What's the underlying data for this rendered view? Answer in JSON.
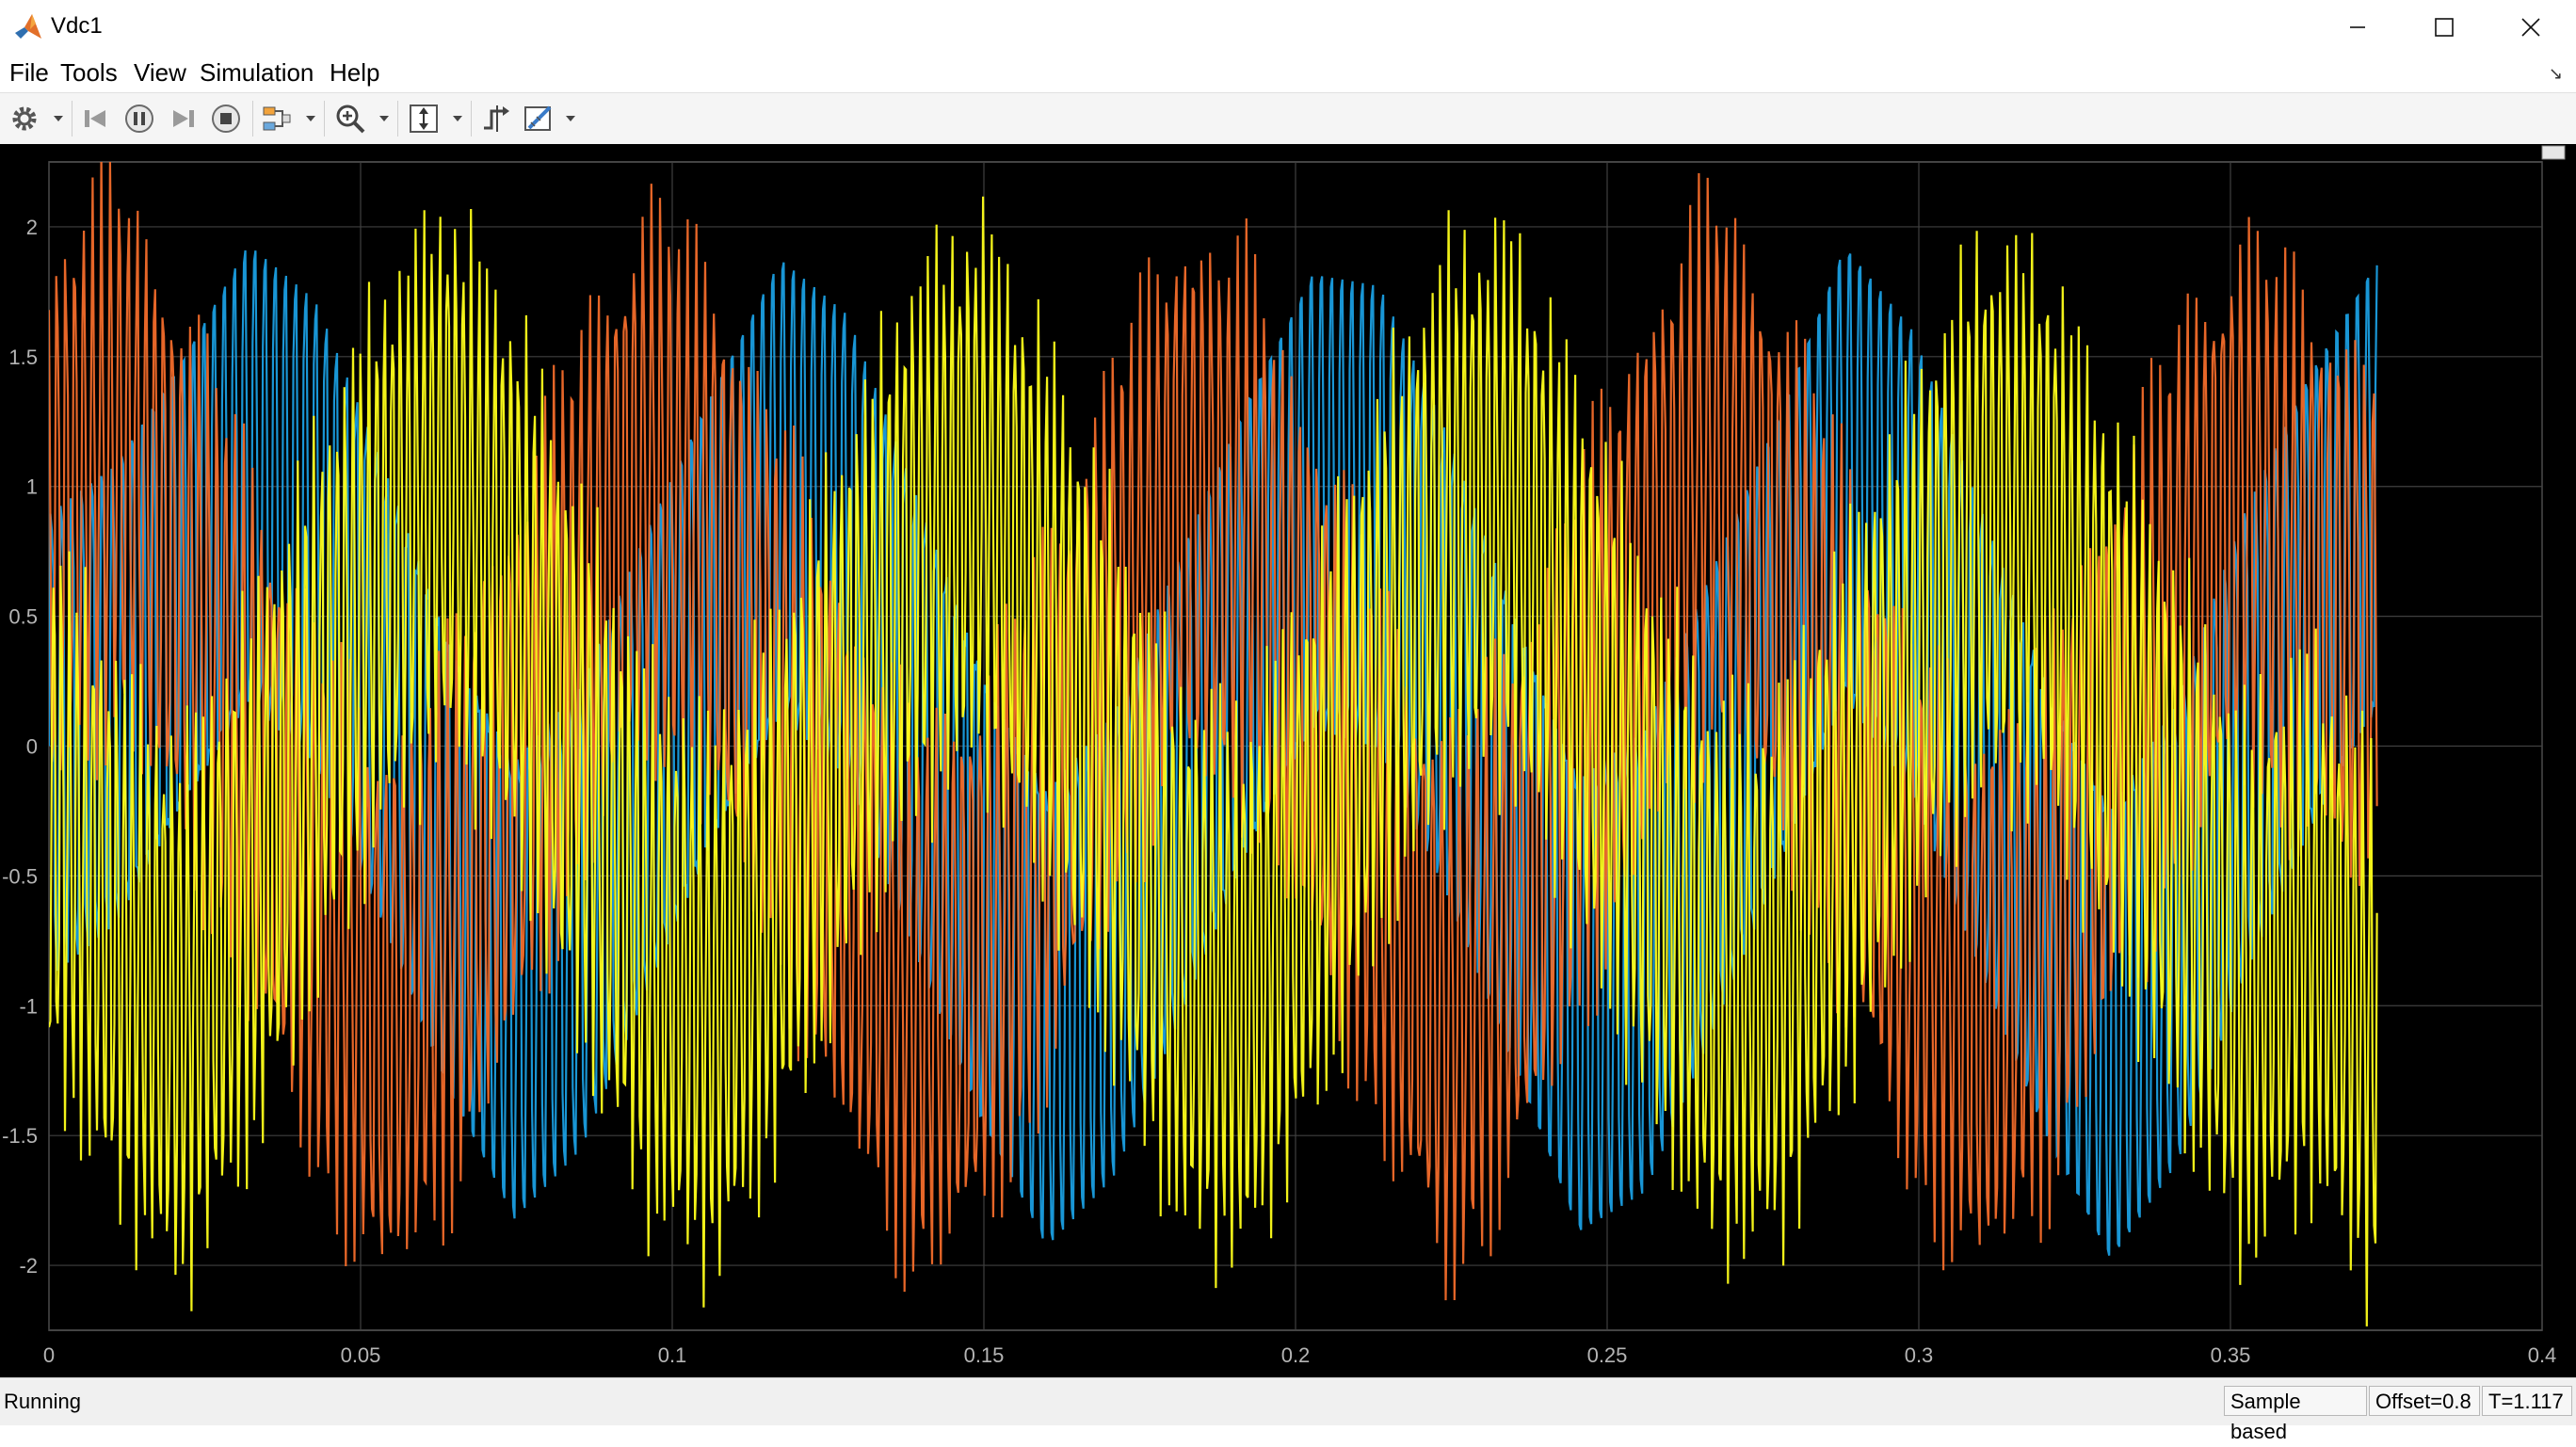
{
  "window": {
    "title": "Vdc1",
    "app_icon": "matlab-icon",
    "minimize_icon": "minimize-icon",
    "maximize_icon": "maximize-icon",
    "close_icon": "close-icon"
  },
  "menu": {
    "items": [
      "File",
      "Tools",
      "View",
      "Simulation",
      "Help"
    ]
  },
  "toolbar": {
    "icons": [
      "settings-icon",
      "step-back-icon",
      "pause-icon",
      "step-forward-icon",
      "stop-icon",
      "highlight-block-icon",
      "zoom-in-icon",
      "scale-axes-icon",
      "triggers-icon",
      "measurements-icon"
    ]
  },
  "status": {
    "left": "Running",
    "sample": "Sample based",
    "offset": "Offset=0.8",
    "time": "T=1.117"
  },
  "colors": {
    "background": "#000000",
    "grid": "#404040",
    "series_blue": "#1a9ee0",
    "series_orange": "#f26b2a",
    "series_yellow": "#ffff1a"
  },
  "chart_data": {
    "type": "line",
    "title": "",
    "xlabel": "",
    "ylabel": "",
    "xlim": [
      0,
      0.4
    ],
    "ylim": [
      -2.25,
      2.25
    ],
    "x_ticks": [
      "0",
      "0.05",
      "0.1",
      "0.15",
      "0.2",
      "0.25",
      "0.3",
      "0.35",
      "0.4"
    ],
    "y_ticks": [
      "2",
      "1.5",
      "1",
      "0.5",
      "0",
      "-0.5",
      "-1",
      "-1.5",
      "-2"
    ],
    "grid": true,
    "data_end_x": 0.3735,
    "series": [
      {
        "color": "#1a9ee0",
        "amplitude": 1.85,
        "samples": [
          0,
          0.35,
          1.1,
          1.9,
          1.5,
          0.4,
          -0.8,
          -1.7,
          -1.2,
          -0.1,
          0.9,
          1.8,
          1.4,
          0.2,
          -1.0,
          -1.9,
          -1.4,
          -0.3,
          0.8,
          1.7,
          1.6,
          0.6,
          -0.6,
          -1.8,
          -1.5,
          -0.4,
          0.7,
          1.9,
          1.3,
          0.1,
          -1.1,
          -2.0,
          -1.3,
          0.0,
          1.0,
          1.8
        ]
      },
      {
        "color": "#f26b2a",
        "amplitude": 1.8,
        "samples": [
          1.5,
          2.1,
          1.2,
          0.1,
          -1.1,
          -1.9,
          -1.3,
          -0.2,
          1.0,
          1.9,
          1.4,
          0.3,
          -0.9,
          -1.8,
          -1.5,
          -0.5,
          0.8,
          1.7,
          1.5,
          0.4,
          -0.8,
          -1.9,
          -1.2,
          0.0,
          1.1,
          2.0,
          1.2,
          0.1,
          -1.2,
          -1.8,
          -1.3,
          -0.1,
          1.0,
          1.7,
          1.2,
          0.8
        ]
      },
      {
        "color": "#ffff1a",
        "amplitude": 1.8,
        "samples": [
          -0.4,
          -1.3,
          -1.9,
          -1.0,
          0.2,
          1.3,
          1.9,
          1.1,
          -0.2,
          -1.4,
          -1.8,
          -0.9,
          0.3,
          1.4,
          1.8,
          0.9,
          -0.3,
          -1.5,
          -1.7,
          -0.7,
          0.5,
          1.6,
          1.7,
          0.6,
          -0.6,
          -1.6,
          -1.6,
          -0.5,
          0.6,
          1.6,
          1.5,
          0.4,
          -0.7,
          -1.7,
          -1.2,
          -2.0
        ]
      }
    ]
  }
}
